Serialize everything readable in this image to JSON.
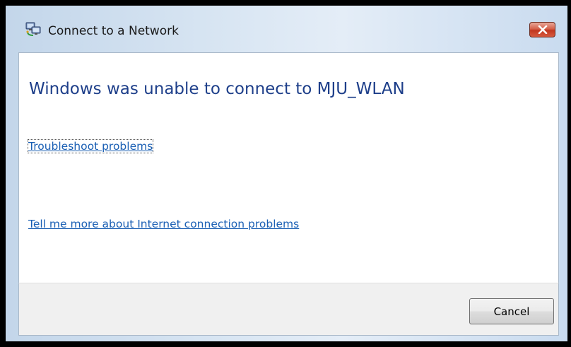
{
  "window": {
    "title": "Connect to a Network",
    "title_icon": "network-connect-icon",
    "close_icon": "close-icon"
  },
  "content": {
    "heading": "Windows was unable to connect to MJU_WLAN",
    "troubleshoot_link": "Troubleshoot problems",
    "tellme_link": "Tell me more about Internet connection problems"
  },
  "footer": {
    "cancel_label": "Cancel"
  },
  "colors": {
    "heading": "#1e3f8a",
    "link": "#1a5fb4",
    "close_button": "#c1361d"
  }
}
